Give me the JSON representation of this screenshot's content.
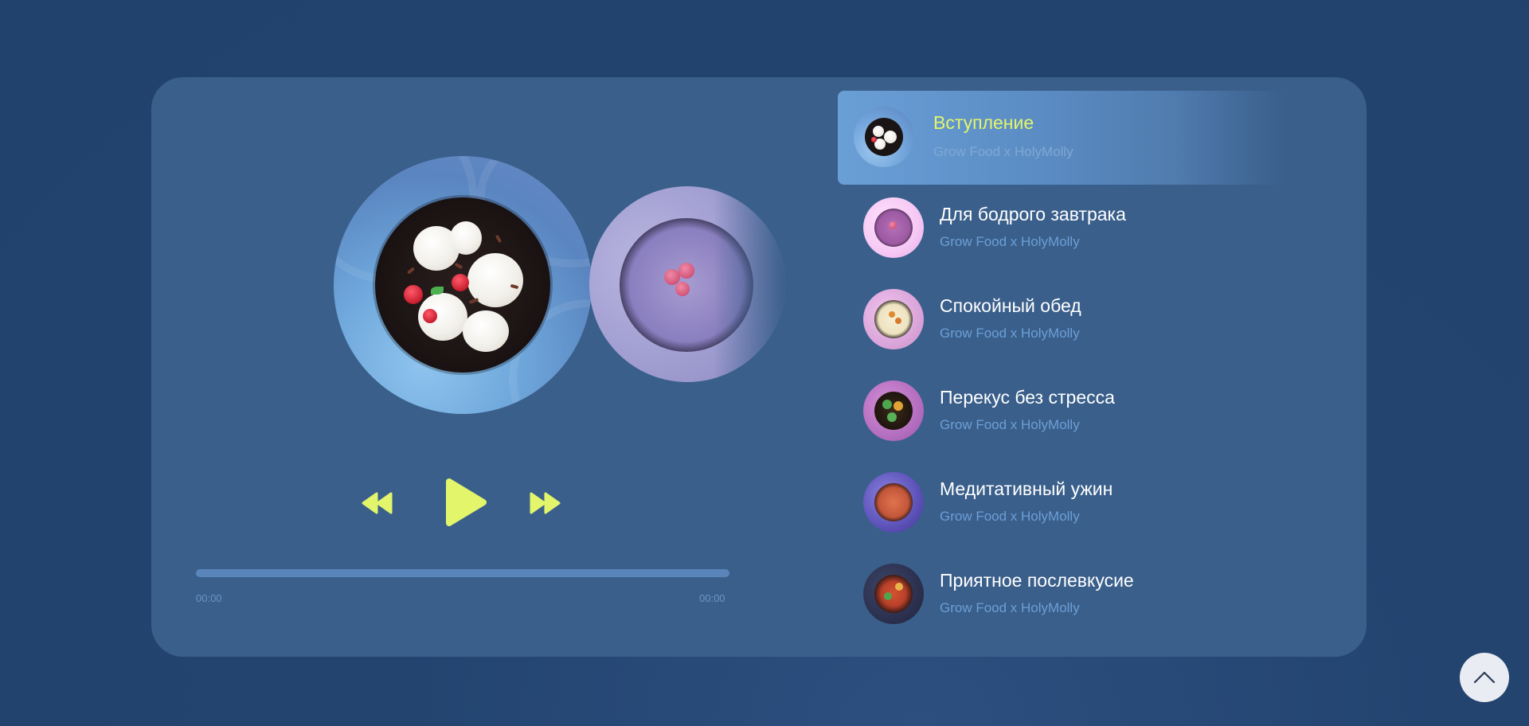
{
  "player": {
    "current_time": "00:00",
    "total_time": "00:00",
    "progress": 0,
    "accent_color": "#e3f56b",
    "controls": {
      "rewind_icon": "rewind-icon",
      "play_icon": "play-icon",
      "forward_icon": "fast-forward-icon"
    }
  },
  "playlist": [
    {
      "title": "Вступление",
      "artist": "Grow Food x HolyMolly",
      "active": true
    },
    {
      "title": "Для бодрого завтрака",
      "artist": "Grow Food x HolyMolly",
      "active": false
    },
    {
      "title": "Спокойный обед",
      "artist": "Grow Food x HolyMolly",
      "active": false
    },
    {
      "title": "Перекус без стресса",
      "artist": "Grow Food x HolyMolly",
      "active": false
    },
    {
      "title": "Медитативный ужин",
      "artist": "Grow Food x HolyMolly",
      "active": false
    },
    {
      "title": "Приятное послевкусие",
      "artist": "Grow Food x HolyMolly",
      "active": false
    }
  ],
  "scroll_top": {
    "icon": "chevron-up-icon"
  }
}
